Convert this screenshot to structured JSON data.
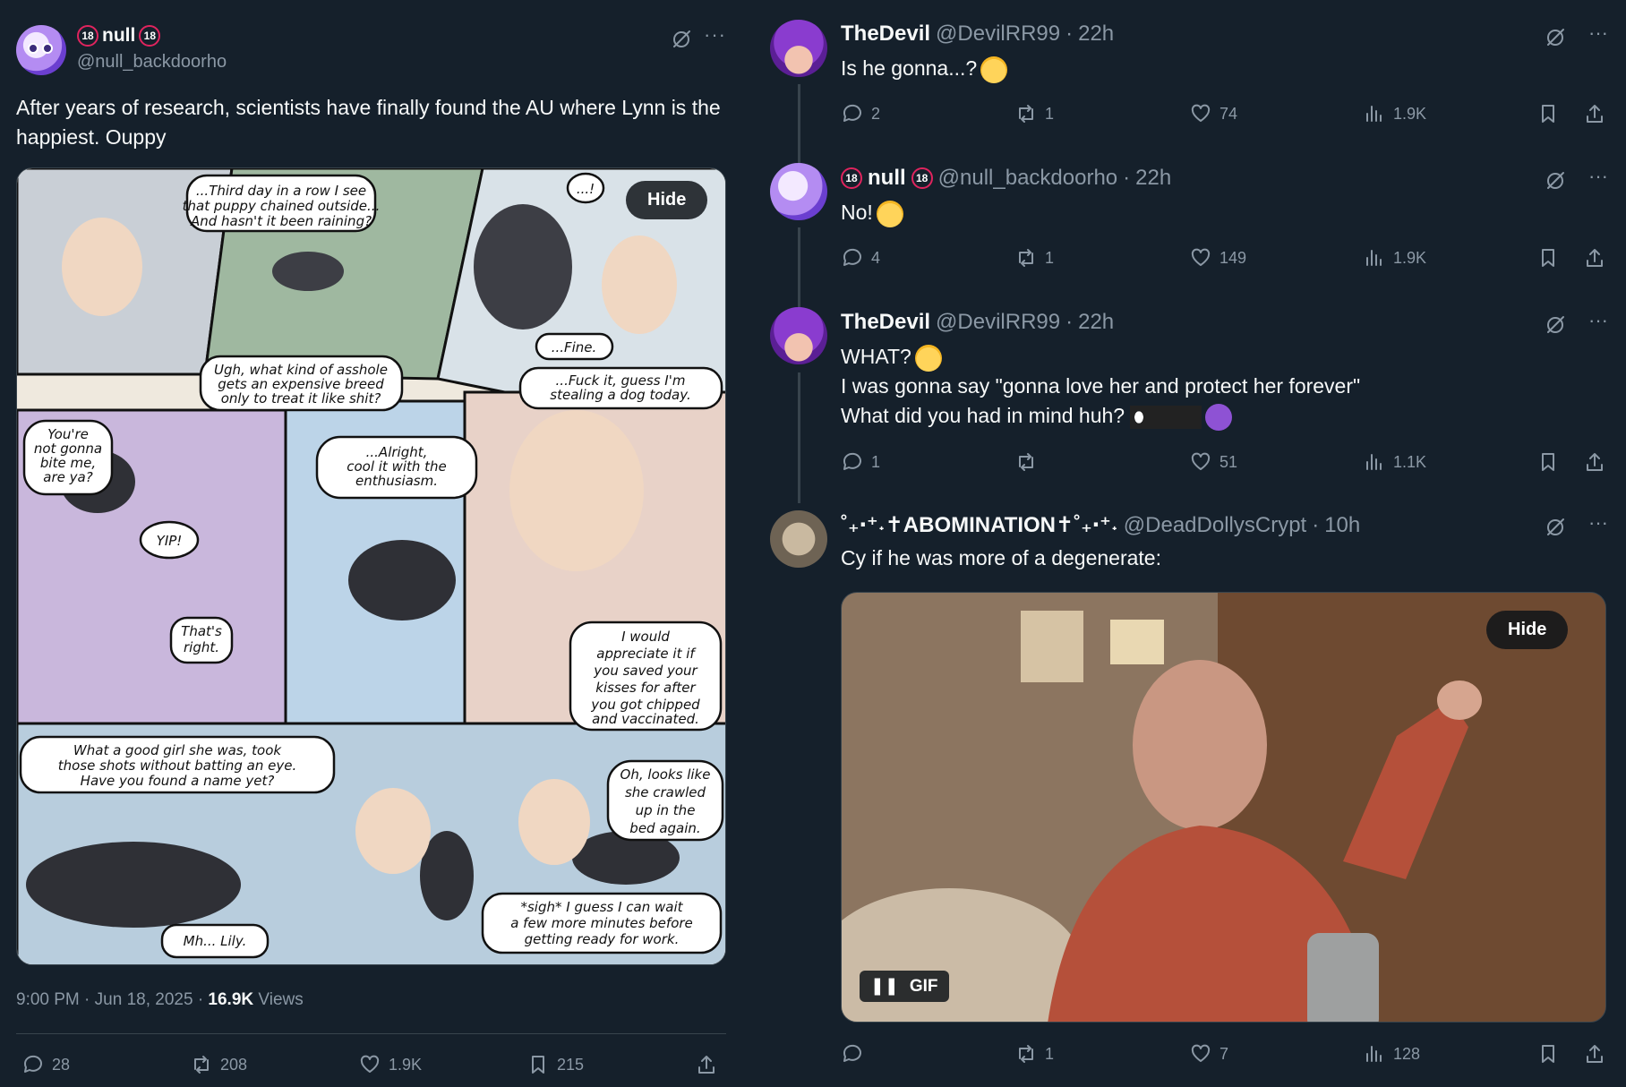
{
  "main_post": {
    "author_name": "null",
    "author_badge": "18",
    "handle": "@null_backdoorho",
    "text": "After years of research, scientists have finally found the AU where Lynn is the happiest. Ouppy",
    "media_hide_label": "Hide",
    "comic_text": [
      "...Third day in a row I see that puppy chained outside... And hasn't it been raining?",
      "...!",
      "...Fine.",
      "Ugh, what kind of asshole gets an expensive breed only to treat it like shit?",
      "...Fuck it, guess I'm stealing a dog today.",
      "You're not gonna bite me, are ya?",
      "...Alright, cool it with the enthusiasm.",
      "YIP!",
      "That's right.",
      "I would appreciate it if you saved your kisses for after you got chipped and vaccinated.",
      "What a good girl she was, took those shots without batting an eye. Have you found a name yet?",
      "Oh, looks like she crawled up in the bed again.",
      "*sigh* I guess I can wait a few more minutes before getting ready for work.",
      "Mh... Lily."
    ],
    "time": "9:00 PM",
    "date": "Jun 18, 2025",
    "views_count": "16.9K",
    "views_label": "Views",
    "replies": "28",
    "reposts": "208",
    "likes": "1.9K",
    "bookmarks": "215"
  },
  "replies": [
    {
      "name": "TheDevil",
      "handle": "@DevilRR99",
      "time": "22h",
      "text": "Is he gonna...?",
      "replies": "2",
      "reposts": "1",
      "likes": "74",
      "views": "1.9K"
    },
    {
      "name": "null",
      "badge": "18",
      "handle": "@null_backdoorho",
      "time": "22h",
      "text": "No!",
      "replies": "4",
      "reposts": "1",
      "likes": "149",
      "views": "1.9K"
    },
    {
      "name": "TheDevil",
      "handle": "@DevilRR99",
      "time": "22h",
      "line1": "WHAT?",
      "line2": "I was gonna say \"gonna love her and protect her forever\"",
      "line3": "What did you had in mind huh?",
      "replies": "1",
      "reposts": "",
      "likes": "51",
      "views": "1.1K"
    },
    {
      "name": "˚₊‧⁺˖✝ABOMINATION✝˚₊‧⁺˖",
      "handle": "@DeadDollysCrypt",
      "time": "10h",
      "text": "Cy if he was more of a degenerate:",
      "media_hide_label": "Hide",
      "gif_label": "GIF",
      "replies": "",
      "reposts": "1",
      "likes": "7",
      "views": "128"
    }
  ],
  "separator": "·",
  "colors": {
    "background": "#15202b",
    "text": "#f7f9f9",
    "muted": "#8b98a5",
    "border": "#38444d"
  }
}
